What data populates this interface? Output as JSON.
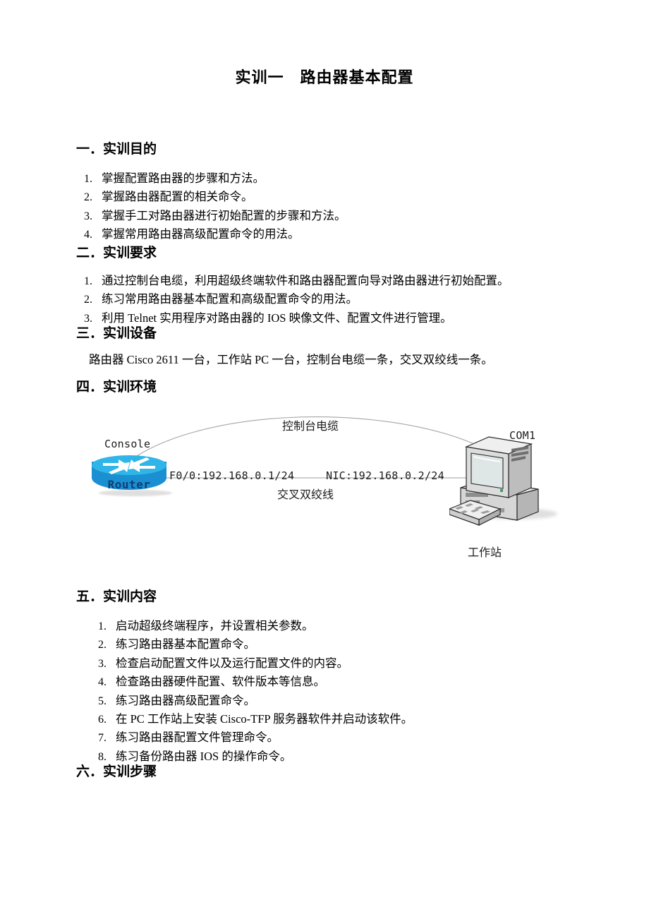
{
  "document": {
    "title": "实训一　路由器基本配置"
  },
  "sections": [
    {
      "heading": "一．实训目的",
      "items": [
        "掌握配置路由器的步骤和方法。",
        "掌握路由器配置的相关命令。",
        "掌握手工对路由器进行初始配置的步骤和方法。",
        "掌握常用路由器高级配置命令的用法。"
      ]
    },
    {
      "heading": "二．实训要求",
      "items": [
        "通过控制台电缆，利用超级终端软件和路由器配置向导对路由器进行初始配置。",
        "练习常用路由器基本配置和高级配置命令的用法。",
        "利用 Telnet 实用程序对路由器的 IOS 映像文件、配置文件进行管理。"
      ]
    },
    {
      "heading": "三．实训设备",
      "paragraph": "路由器 Cisco 2611 一台，工作站 PC 一台，控制台电缆一条，交叉双绞线一条。"
    },
    {
      "heading": "四．实训环境"
    },
    {
      "heading": "五．实训内容",
      "items": [
        "启动超级终端程序，并设置相关参数。",
        "练习路由器基本配置命令。",
        "检查启动配置文件以及运行配置文件的内容。",
        "检查路由器硬件配置、软件版本等信息。",
        "练习路由器高级配置命令。",
        "在 PC 工作站上安装 Cisco-TFP 服务器软件并启动该软件。",
        "练习路由器配置文件管理命令。",
        "练习备份路由器 IOS 的操作命令。"
      ]
    },
    {
      "heading": "六．实训步骤"
    }
  ],
  "numbering": [
    "1.",
    "2.",
    "3.",
    "4.",
    "5.",
    "6.",
    "7.",
    "8."
  ],
  "diagram": {
    "console_cable_label": "控制台电缆",
    "console_port_label": "Console",
    "router_label": "Router",
    "router_interface_label": "F0/0:192.168.0.1/24",
    "nic_label": "NIC:192.168.0.2/24",
    "crossover_label": "交叉双绞线",
    "com_port_label": "COM1",
    "workstation_label": "工作站",
    "colors": {
      "router_top": "#2fb5e8",
      "router_body": "#1a8fd1",
      "router_text": "#0d3f73",
      "line": "#9a9a9a",
      "pc_light": "#e8e8e8",
      "pc_mid": "#c9c9c9",
      "pc_dark": "#7a7a7a",
      "screen": "#dfe6e6"
    }
  }
}
